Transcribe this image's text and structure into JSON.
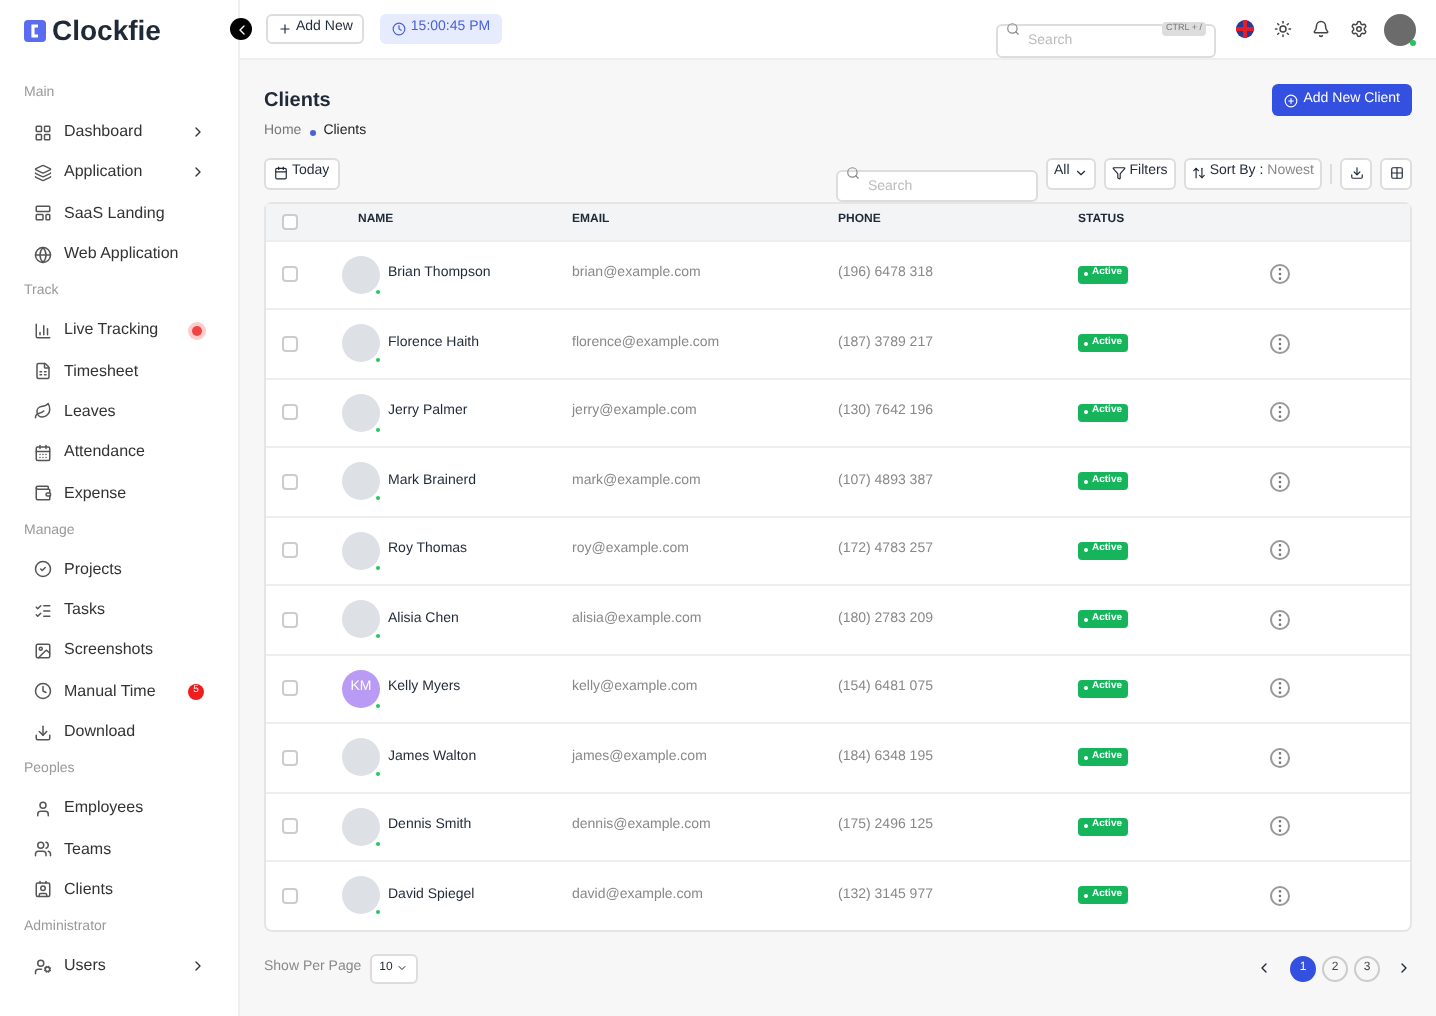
{
  "brand": "Clockfie",
  "header": {
    "add_new": "Add New",
    "clock": "15:00:45 PM",
    "search_placeholder": "Search",
    "shortcut": "CTRL + /"
  },
  "sidebar": [
    {
      "title": "Main",
      "items": [
        {
          "label": "Dashboard",
          "submenu": true,
          "dot": false
        },
        {
          "label": "Application",
          "submenu": true,
          "dot": false
        },
        {
          "label": "SaaS Landing",
          "submenu": false,
          "dot": false
        },
        {
          "label": "Web Application",
          "submenu": false,
          "dot": false
        }
      ]
    },
    {
      "title": "Track",
      "items": [
        {
          "label": "Live Tracking",
          "submenu": false,
          "dot": true
        },
        {
          "label": "Timesheet",
          "submenu": false,
          "dot": false
        },
        {
          "label": "Leaves",
          "submenu": false,
          "dot": false
        },
        {
          "label": "Attendance",
          "submenu": false,
          "dot": false
        },
        {
          "label": "Expense",
          "submenu": false,
          "dot": false
        }
      ]
    },
    {
      "title": "Manage",
      "items": [
        {
          "label": "Projects",
          "submenu": false,
          "dot": false
        },
        {
          "label": "Tasks",
          "submenu": false,
          "dot": false
        },
        {
          "label": "Screenshots",
          "submenu": false,
          "dot": false
        },
        {
          "label": "Manual Time",
          "submenu": false,
          "dot": false,
          "badge": "5"
        },
        {
          "label": "Download",
          "submenu": false,
          "dot": false
        }
      ]
    },
    {
      "title": "Peoples",
      "items": [
        {
          "label": "Employees",
          "submenu": false,
          "dot": false
        },
        {
          "label": "Teams",
          "submenu": false,
          "dot": false
        },
        {
          "label": "Clients",
          "submenu": false,
          "dot": false
        }
      ]
    },
    {
      "title": "Administrator",
      "items": [
        {
          "label": "Users",
          "submenu": true,
          "dot": false
        }
      ]
    }
  ],
  "page": {
    "title": "Clients",
    "breadcrumb": [
      "Home",
      "Clients"
    ],
    "add_button": "Add New Client"
  },
  "toolbar": {
    "today": "Today",
    "search_placeholder": "Search",
    "filter_value": "All",
    "filters": "Filters",
    "sort_label": "Sort By :",
    "sort_value": "Nowest"
  },
  "table": {
    "select_all_checked": false,
    "columns": [
      "NAME",
      "EMAIL",
      "PHONE",
      "STATUS"
    ],
    "rows": [
      {
        "checked": false,
        "name": "Brian Thompson",
        "email": "brian@example.com",
        "phone": "(196) 6478 318",
        "status": "Active",
        "avatar": {
          "kind": "photo"
        }
      },
      {
        "checked": false,
        "name": "Florence Haith",
        "email": "florence@example.com",
        "phone": "(187) 3789 217",
        "status": "Active",
        "avatar": {
          "kind": "photo"
        }
      },
      {
        "checked": false,
        "name": "Jerry Palmer",
        "email": "jerry@example.com",
        "phone": "(130) 7642 196",
        "status": "Active",
        "avatar": {
          "kind": "photo"
        }
      },
      {
        "checked": false,
        "name": "Mark Brainerd",
        "email": "mark@example.com",
        "phone": "(107) 4893 387",
        "status": "Active",
        "avatar": {
          "kind": "photo"
        }
      },
      {
        "checked": false,
        "name": "Roy Thomas",
        "email": "roy@example.com",
        "phone": "(172) 4783 257",
        "status": "Active",
        "avatar": {
          "kind": "photo"
        }
      },
      {
        "checked": false,
        "name": "Alisia Chen",
        "email": "alisia@example.com",
        "phone": "(180) 2783 209",
        "status": "Active",
        "avatar": {
          "kind": "photo"
        }
      },
      {
        "checked": false,
        "name": "Kelly Myers",
        "email": "kelly@example.com",
        "phone": "(154) 6481 075",
        "status": "Active",
        "avatar": {
          "kind": "initials",
          "initials": "KM"
        }
      },
      {
        "checked": false,
        "name": "James Walton",
        "email": "james@example.com",
        "phone": "(184) 6348 195",
        "status": "Active",
        "avatar": {
          "kind": "photo"
        }
      },
      {
        "checked": false,
        "name": "Dennis Smith",
        "email": "dennis@example.com",
        "phone": "(175) 2496 125",
        "status": "Active",
        "avatar": {
          "kind": "photo"
        }
      },
      {
        "checked": false,
        "name": "David Spiegel",
        "email": "david@example.com",
        "phone": "(132) 3145 977",
        "status": "Active",
        "avatar": {
          "kind": "photo"
        }
      }
    ]
  },
  "footer": {
    "per_page_label": "Show Per Page",
    "per_page": "10",
    "pages": [
      {
        "label": "1",
        "selected": true
      },
      {
        "label": "2",
        "selected": false
      },
      {
        "label": "3",
        "selected": false
      }
    ]
  }
}
